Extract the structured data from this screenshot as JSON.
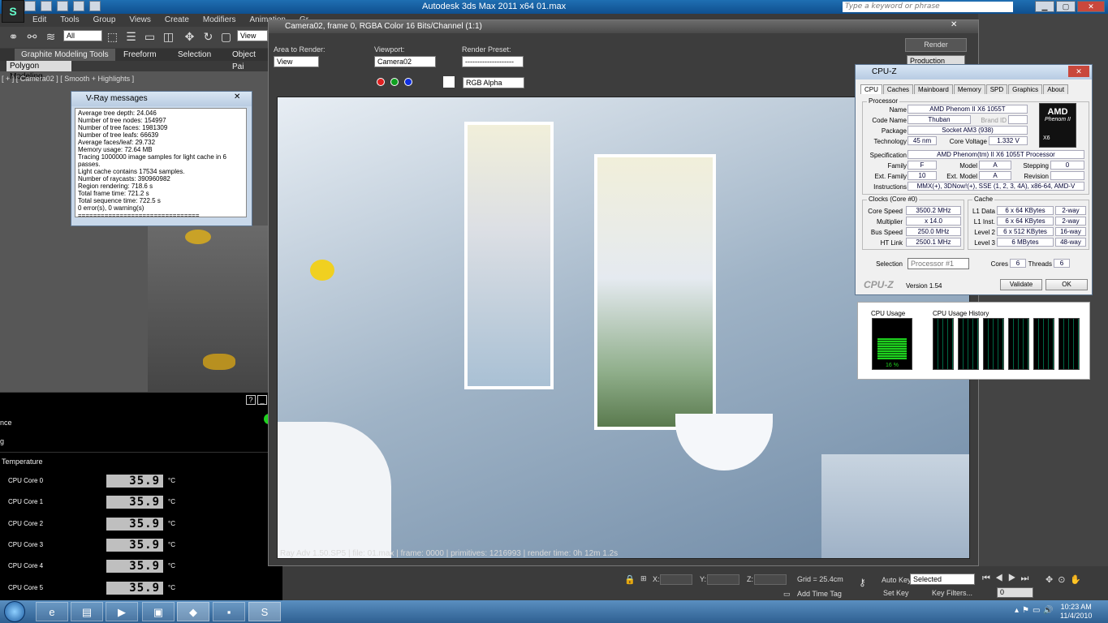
{
  "max": {
    "title": "Autodesk 3ds Max  2011 x64     01.max",
    "search_placeholder": "Type a keyword or phrase",
    "menu": [
      "Edit",
      "Tools",
      "Group",
      "Views",
      "Create",
      "Modifiers",
      "Animation",
      "Gr"
    ],
    "toolbar_select": "All",
    "toolbar_view": "View",
    "ribbon_tabs": [
      "Graphite Modeling Tools",
      "Freeform",
      "Selection",
      "Object Pai"
    ],
    "poly_modeling": "Polygon Modeling",
    "viewport_label": "[ + ] [ Camera02 ] [ Smooth + Highlights ]",
    "render_btn": "Render",
    "production": "Production"
  },
  "vray": {
    "title": "V-Ray messages",
    "lines": [
      "Average tree depth: 24.046",
      "Number of tree nodes: 154997",
      "Number of tree faces: 1981309",
      "Number of tree leafs: 66639",
      "Average faces/leaf: 29.732",
      "Memory usage: 72.64 MB",
      "Tracing 1000000 image samples for light cache in 6 passes.",
      "Light cache contains 17534 samples.",
      "Number of raycasts: 390960982",
      "Region rendering: 718.6 s",
      "Total frame time: 721.2 s",
      "Total sequence time: 722.5 s",
      "0 error(s), 0 warning(s)",
      "================================"
    ]
  },
  "temp": {
    "frag1": "nce",
    "frag2": "g",
    "header": "Temperature",
    "unit": "°C",
    "cores": [
      {
        "label": "CPU Core 0",
        "value": "35.9"
      },
      {
        "label": "CPU Core 1",
        "value": "35.9"
      },
      {
        "label": "CPU Core 2",
        "value": "35.9"
      },
      {
        "label": "CPU Core 3",
        "value": "35.9"
      },
      {
        "label": "CPU Core 4",
        "value": "35.9"
      },
      {
        "label": "CPU Core 5",
        "value": "35.9"
      }
    ]
  },
  "rfw": {
    "title": "Camera02, frame 0, RGBA Color 16 Bits/Channel (1:1)",
    "area_label": "Area to Render:",
    "area_value": "View",
    "viewport_label": "Viewport:",
    "viewport_value": "Camera02",
    "preset_label": "Render Preset:",
    "preset_value": "--------------------",
    "channel": "RGB Alpha",
    "status": "Ray Adv 1.50.SP5 | file: 01.max | frame: 0000 | primitives: 1216993 | render time: 0h 12m 1.2s"
  },
  "cpuz": {
    "title": "CPU-Z",
    "tabs": [
      "CPU",
      "Caches",
      "Mainboard",
      "Memory",
      "SPD",
      "Graphics",
      "About"
    ],
    "processor_legend": "Processor",
    "name_k": "Name",
    "name_v": "AMD Phenom II X6 1055T",
    "code_k": "Code Name",
    "code_v": "Thuban",
    "brand_k": "Brand ID",
    "pkg_k": "Package",
    "pkg_v": "Socket AM3 (938)",
    "tech_k": "Technology",
    "tech_v": "45 nm",
    "volt_k": "Core Voltage",
    "volt_v": "1.332 V",
    "spec_k": "Specification",
    "spec_v": "AMD Phenom(tm) II X6 1055T Processor",
    "fam_k": "Family",
    "fam_v": "F",
    "model_k": "Model",
    "model_v": "A",
    "step_k": "Stepping",
    "step_v": "0",
    "efam_k": "Ext. Family",
    "efam_v": "10",
    "emodel_k": "Ext. Model",
    "emodel_v": "A",
    "rev_k": "Revision",
    "instr_k": "Instructions",
    "instr_v": "MMX(+), 3DNow!(+), SSE (1, 2, 3, 4A), x86-64, AMD-V",
    "clocks_legend": "Clocks (Core #0)",
    "cs_k": "Core Speed",
    "cs_v": "3500.2 MHz",
    "mul_k": "Multiplier",
    "mul_v": "x 14.0",
    "bus_k": "Bus Speed",
    "bus_v": "250.0 MHz",
    "ht_k": "HT Link",
    "ht_v": "2500.1 MHz",
    "cache_legend": "Cache",
    "l1d_k": "L1 Data",
    "l1d_v": "6 x 64 KBytes",
    "l1d_w": "2-way",
    "l1i_k": "L1 Inst.",
    "l1i_v": "6 x 64 KBytes",
    "l1i_w": "2-way",
    "l2_k": "Level 2",
    "l2_v": "6 x 512 KBytes",
    "l2_w": "16-way",
    "l3_k": "Level 3",
    "l3_v": "6 MBytes",
    "l3_w": "48-way",
    "sel_k": "Selection",
    "sel_v": "Processor #1",
    "cores_k": "Cores",
    "cores_v": "6",
    "threads_k": "Threads",
    "threads_v": "6",
    "brand_footer": "CPU-Z",
    "version": "Version 1.54",
    "validate": "Validate",
    "ok": "OK",
    "amd": "AMD",
    "phenom": "Phenom II",
    "x6": "X6"
  },
  "usage": {
    "cpu_usage": "CPU Usage",
    "history": "CPU Usage History",
    "percent": "16 %",
    "level": 0.16
  },
  "status": {
    "x": "X:",
    "y": "Y:",
    "z": "Z:",
    "grid": "Grid = 25.4cm",
    "autokey": "Auto Key",
    "selected": "Selected",
    "setkey": "Set Key",
    "keyfilters": "Key Filters...",
    "addtimetag": "Add Time Tag",
    "frame": "0"
  },
  "clock": {
    "time": "10:23 AM",
    "date": "11/4/2010"
  }
}
